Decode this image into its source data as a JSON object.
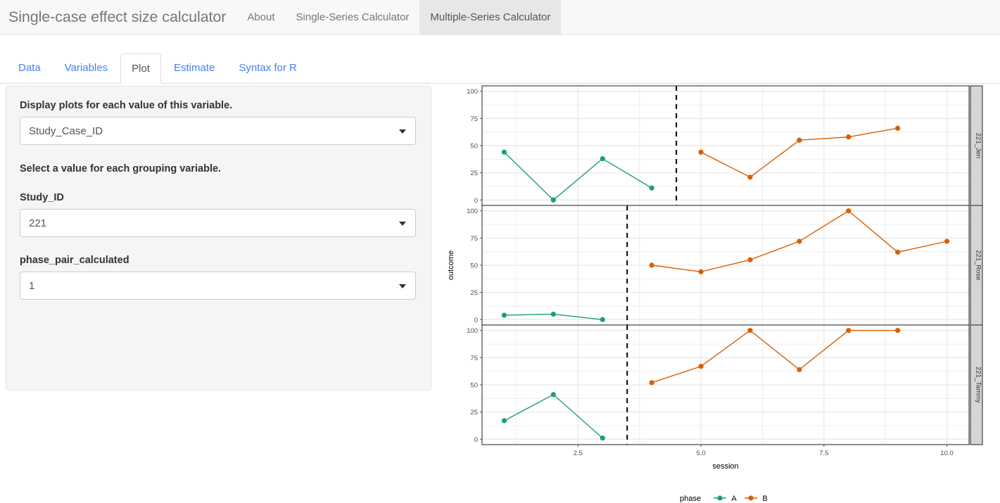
{
  "navbar": {
    "brand": "Single-case effect size calculator",
    "items": [
      {
        "label": "About",
        "active": false
      },
      {
        "label": "Single-Series Calculator",
        "active": false
      },
      {
        "label": "Multiple-Series Calculator",
        "active": true
      }
    ]
  },
  "tabs": [
    {
      "label": "Data",
      "active": false
    },
    {
      "label": "Variables",
      "active": false
    },
    {
      "label": "Plot",
      "active": true
    },
    {
      "label": "Estimate",
      "active": false
    },
    {
      "label": "Syntax for R",
      "active": false
    }
  ],
  "sidebar": {
    "facet_label": "Display plots for each value of this variable.",
    "facet_select": {
      "value": "Study_Case_ID",
      "placeholder": "Study_Case_ID"
    },
    "group_label": "Select a value for each grouping variable.",
    "study_id_label": "Study_ID",
    "study_id_select": {
      "value": "221",
      "placeholder": "221"
    },
    "phase_pair_label": "phase_pair_calculated",
    "phase_pair_select": {
      "value": "1",
      "placeholder": "1"
    }
  },
  "colors": {
    "phase_a": "#1b9e77",
    "phase_b": "#d95f02",
    "panel_border": "#333333",
    "grid": "#ebebeb",
    "strip_bg": "#d5d5d5",
    "axis_text": "#4d4d4d",
    "nav_active_bg": "#e7e7e7",
    "tab_link": "#4582ec",
    "well_bg": "#f5f5f5"
  },
  "chart_data": {
    "type": "line",
    "title": "",
    "xlabel": "session",
    "ylabel": "outcome",
    "xlim": [
      0.55,
      10.45
    ],
    "ylim": [
      -5,
      105
    ],
    "xticks": [
      2.5,
      5.0,
      7.5,
      10.0
    ],
    "xticklabels": [
      "2.5",
      "5.0",
      "7.5",
      "10.0"
    ],
    "yticks": [
      0,
      25,
      50,
      75,
      100
    ],
    "yticklabels": [
      "0",
      "25",
      "50",
      "75",
      "100"
    ],
    "grid": true,
    "legend": {
      "title": "phase",
      "position": "bottom",
      "entries": [
        "A",
        "B"
      ]
    },
    "facet_var": "Study_Case_ID",
    "facets": [
      {
        "label": "221_Jen",
        "phase_change_line": 4.5,
        "series": [
          {
            "name": "A",
            "x": [
              1,
              2,
              3,
              4
            ],
            "values": [
              44,
              0,
              38,
              11
            ]
          },
          {
            "name": "B",
            "x": [
              5,
              6,
              7,
              8,
              9
            ],
            "values": [
              44,
              21,
              55,
              58,
              66
            ]
          }
        ]
      },
      {
        "label": "221_Rose",
        "phase_change_line": 3.5,
        "series": [
          {
            "name": "A",
            "x": [
              1,
              2,
              3
            ],
            "values": [
              4,
              5,
              0
            ]
          },
          {
            "name": "B",
            "x": [
              4,
              5,
              6,
              7,
              8,
              9,
              10
            ],
            "values": [
              50,
              44,
              55,
              72,
              100,
              62,
              72
            ]
          }
        ]
      },
      {
        "label": "221_Tammy",
        "phase_change_line": 3.5,
        "series": [
          {
            "name": "A",
            "x": [
              1,
              2,
              3
            ],
            "values": [
              17,
              41,
              1
            ]
          },
          {
            "name": "B",
            "x": [
              4,
              5,
              6,
              7,
              8,
              9
            ],
            "values": [
              52,
              67,
              100,
              64,
              100,
              100
            ]
          }
        ]
      }
    ]
  }
}
